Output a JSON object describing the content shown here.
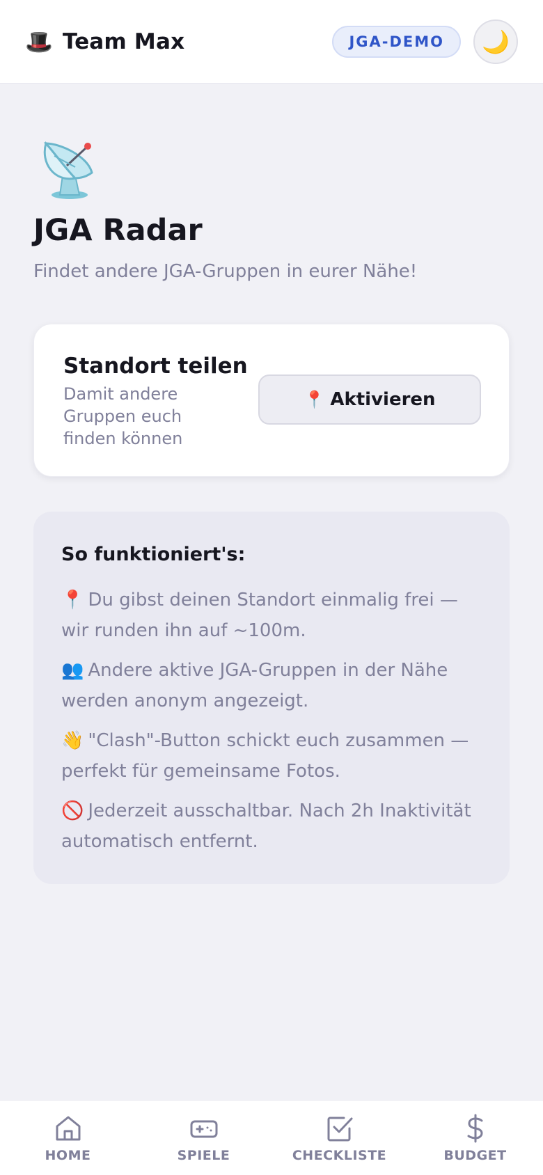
{
  "header": {
    "brand_emoji": "🎩",
    "team_name": "Team Max",
    "badge": "JGA-DEMO",
    "theme_toggle_emoji": "🌙"
  },
  "page": {
    "icon": "satellite-dish-icon",
    "title": "JGA Radar",
    "subtitle": "Findet andere JGA-Gruppen in eurer Nähe!"
  },
  "share_card": {
    "title": "Standort teilen",
    "description": "Damit andere Gruppen euch finden können",
    "button_emoji": "📍",
    "button_label": "Aktivieren"
  },
  "how_it_works": {
    "title": "So funktioniert's:",
    "items": [
      {
        "emoji": "📍",
        "text": "Du gibst deinen Standort einmalig frei — wir runden ihn auf ~100m."
      },
      {
        "emoji": "👥",
        "text": "Andere aktive JGA-Gruppen in der Nähe werden anonym angezeigt."
      },
      {
        "emoji": "👋",
        "text": "\"Clash\"-Button schickt euch zusammen — perfekt für gemeinsame Fotos."
      },
      {
        "emoji": "🚫",
        "text": "Jederzeit ausschaltbar. Nach 2h Inaktivität automatisch entfernt."
      }
    ]
  },
  "bottom_nav": {
    "items": [
      {
        "label": "HOME",
        "icon": "home-icon"
      },
      {
        "label": "SPIELE",
        "icon": "gamepad-icon"
      },
      {
        "label": "CHECKLISTE",
        "icon": "checkbox-icon"
      },
      {
        "label": "BUDGET",
        "icon": "dollar-icon"
      }
    ]
  },
  "colors": {
    "accent": "#2f55c8",
    "background": "#f1f1f6",
    "muted_text": "#80809a"
  }
}
